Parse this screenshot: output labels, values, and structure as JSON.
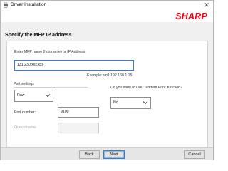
{
  "window": {
    "title": "Driver Installation",
    "close_symbol": "✕"
  },
  "header": {
    "brand": "SHARP",
    "brand_color": "#e60012"
  },
  "page": {
    "title": "Specify the MFP IP address"
  },
  "address": {
    "label": "Enter MFP name (hostname) or IP Address.",
    "value": "131.230.xxx.xxx",
    "example": "Example:pm1,192.168.1.15"
  },
  "port_settings": {
    "label": "Port settings",
    "protocol_selected": "Raw",
    "port_number_label": "Port number:",
    "port_number_value": "9100",
    "queue_name_label": "Queue name:",
    "queue_name_value": ""
  },
  "tandem": {
    "question": "Do you want to use 'Tandem Print' function?",
    "selected": "No"
  },
  "buttons": {
    "back": "Back",
    "next": "Next",
    "cancel": "Cancel"
  },
  "icons": {
    "app": "printer-icon",
    "dropdown": "chevron-down-icon",
    "close": "close-icon"
  }
}
